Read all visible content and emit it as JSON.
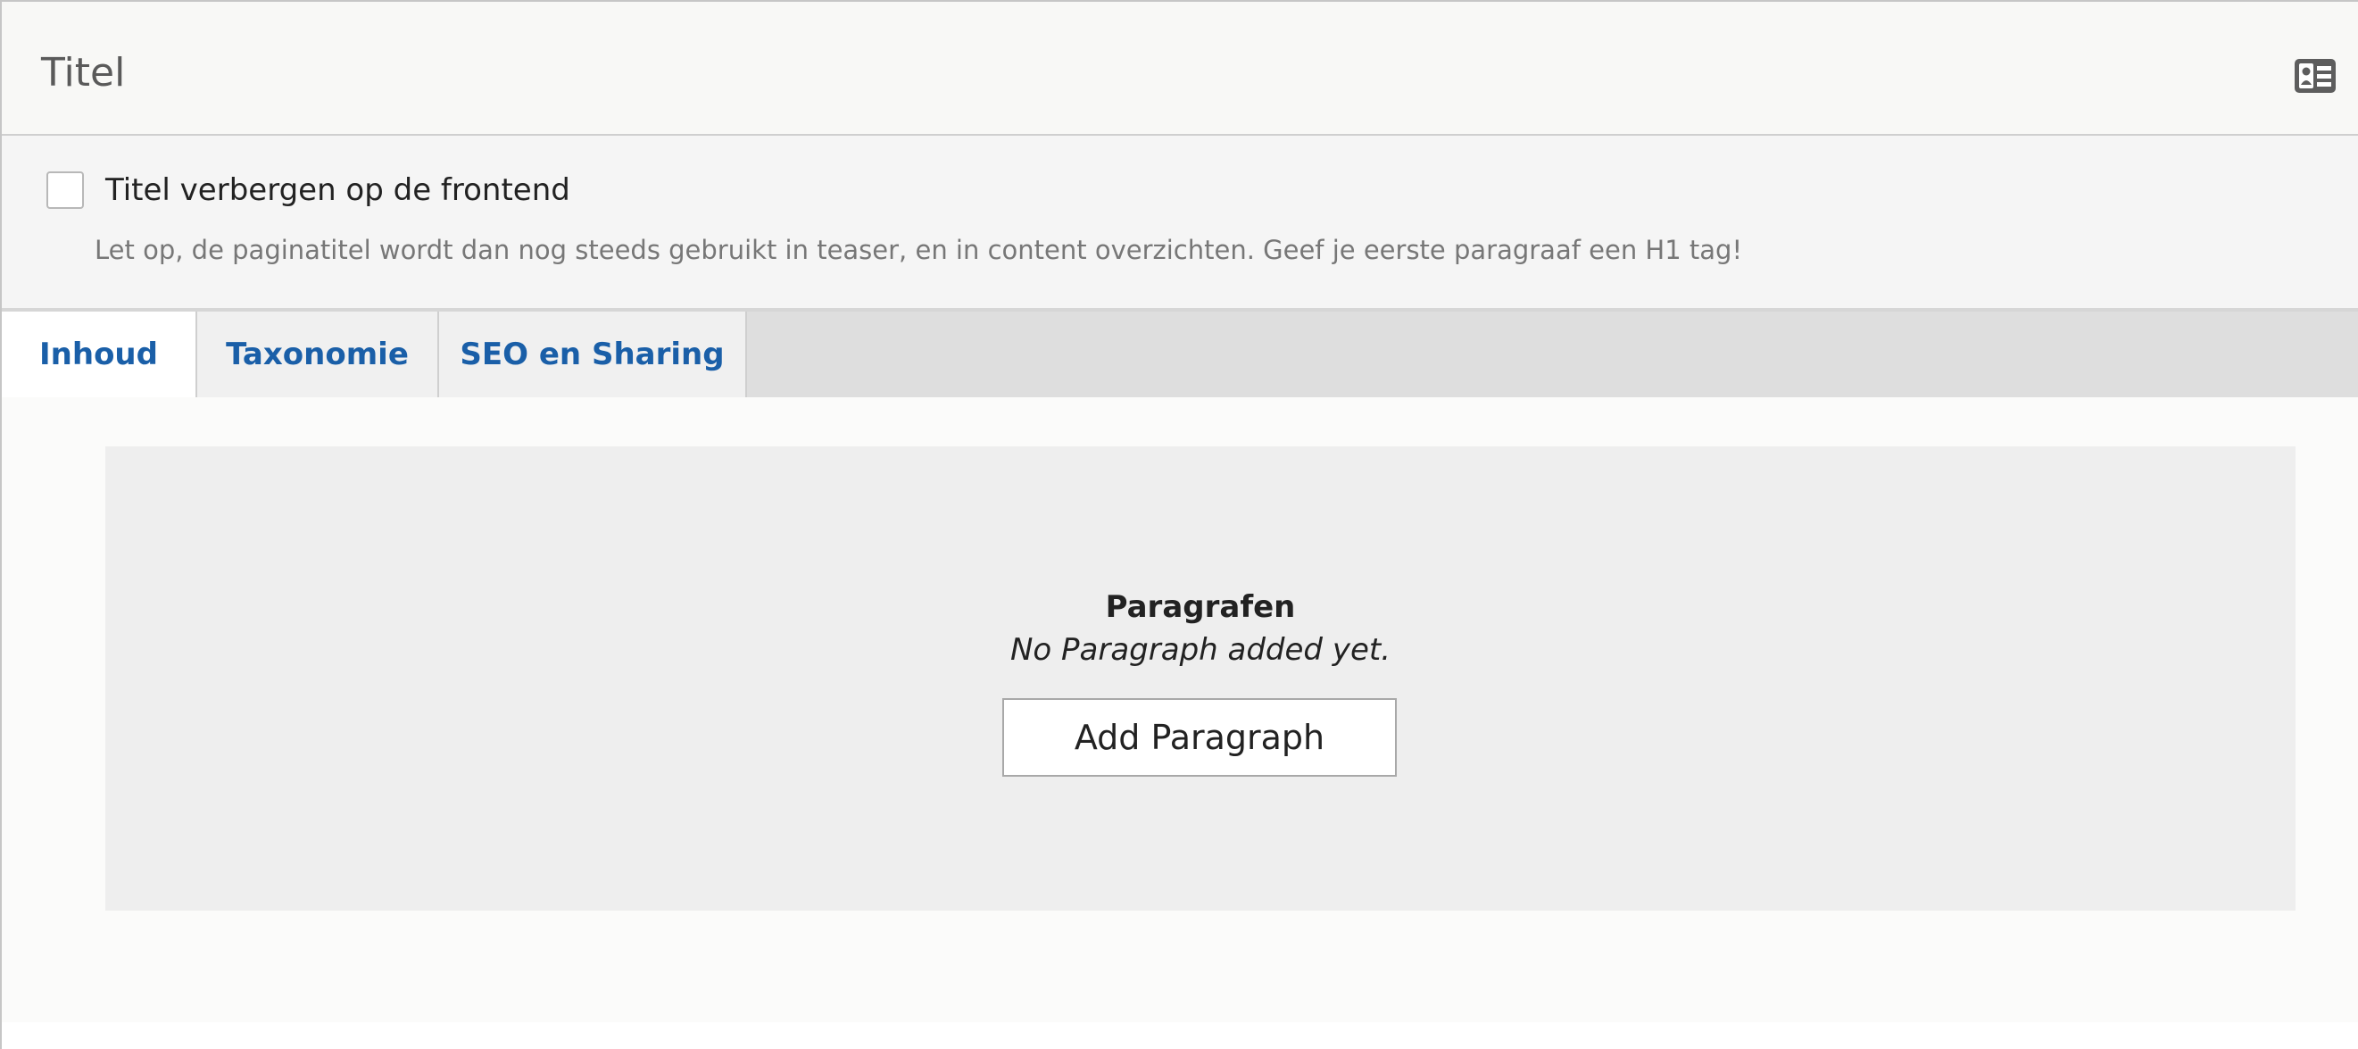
{
  "title_field": {
    "value": "Titel"
  },
  "hide_title": {
    "label": "Titel verbergen op de frontend",
    "checked": false,
    "description": "Let op, de paginatitel wordt dan nog steeds gebruikt in teaser, en in content overzichten. Geef je eerste paragraaf een H1 tag!"
  },
  "tabs": [
    {
      "label": "Inhoud",
      "active": true
    },
    {
      "label": "Taxonomie",
      "active": false
    },
    {
      "label": "SEO en Sharing",
      "active": false
    }
  ],
  "paragraphs": {
    "heading": "Paragrafen",
    "empty_text": "No Paragraph added yet.",
    "add_button": "Add Paragraph"
  },
  "icons": {
    "title_icon": "contact-card-icon"
  },
  "colors": {
    "tab_text": "#1a5fa8",
    "panel_bg": "#eeeeee"
  }
}
